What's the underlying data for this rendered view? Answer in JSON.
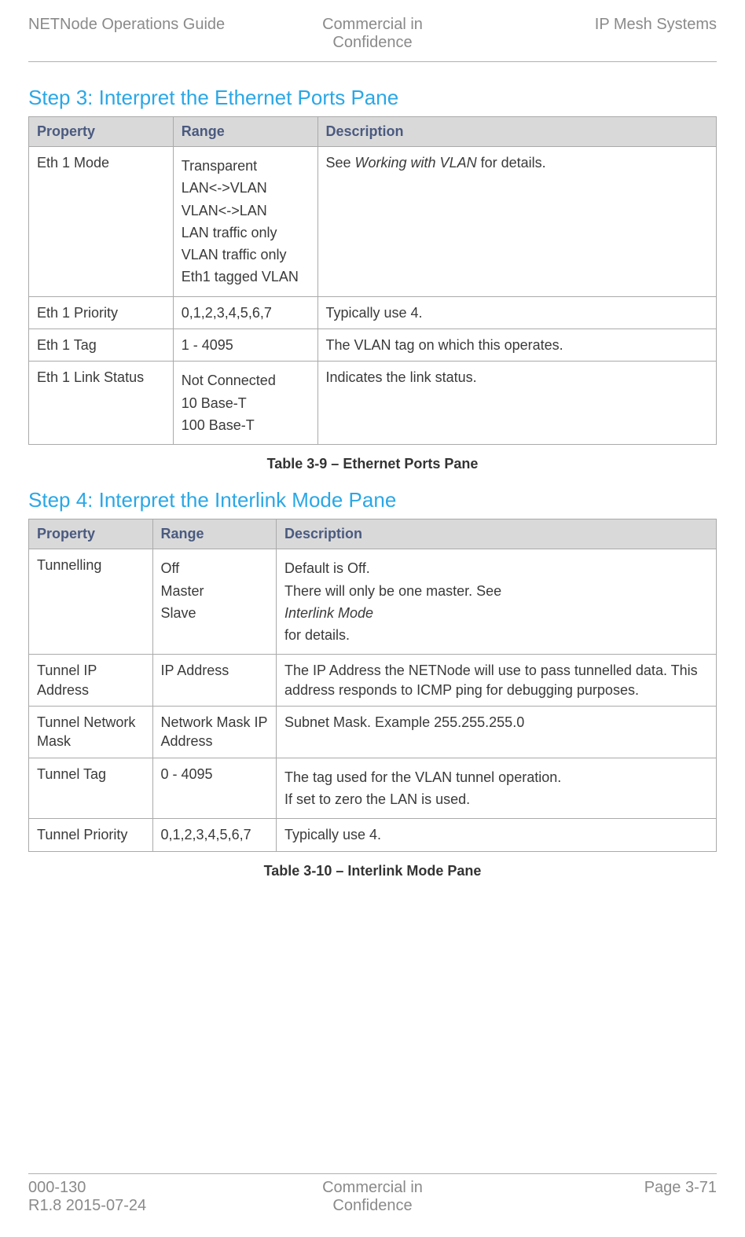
{
  "header": {
    "left": "NETNode Operations Guide",
    "center_l1": "Commercial in",
    "center_l2": "Confidence",
    "right": "IP Mesh Systems"
  },
  "step3": {
    "title": "Step 3: Interpret the Ethernet Ports Pane",
    "cols": {
      "c1": "Property",
      "c2": "Range",
      "c3": "Description"
    },
    "rows": [
      {
        "p": "Eth 1 Mode",
        "r": [
          "Transparent",
          "LAN<->VLAN",
          "VLAN<->LAN",
          "LAN traffic only",
          "VLAN traffic only",
          "Eth1 tagged VLAN"
        ],
        "d_pre": "See ",
        "d_ital": "Working with VLAN",
        "d_post": " for details."
      },
      {
        "p": "Eth 1 Priority",
        "r": [
          "0,1,2,3,4,5,6,7"
        ],
        "d": "Typically use 4."
      },
      {
        "p": "Eth 1 Tag",
        "r": [
          "1 - 4095"
        ],
        "d": "The VLAN tag on which this operates."
      },
      {
        "p": "Eth 1 Link Status",
        "r": [
          "Not Connected",
          "10 Base-T",
          "100 Base-T"
        ],
        "d": "Indicates the link status."
      }
    ],
    "caption": "Table 3-9 – Ethernet Ports Pane"
  },
  "step4": {
    "title": "Step 4: Interpret the Interlink Mode Pane",
    "cols": {
      "c1": "Property",
      "c2": "Range",
      "c3": "Description"
    },
    "rows": [
      {
        "p": "Tunnelling",
        "r": [
          "Off",
          "Master",
          "Slave"
        ],
        "d_lines": [
          {
            "t": "Default is Off."
          },
          {
            "pre": "There will only be one master. See ",
            "ital": "Interlink Mode",
            "post": " for details."
          }
        ]
      },
      {
        "p": "Tunnel IP Address",
        "r": [
          "IP Address"
        ],
        "d": "The IP Address the NETNode will use to pass tunnelled data. This address responds to ICMP ping for debugging purposes."
      },
      {
        "p": "Tunnel Network Mask",
        "r": [
          "Network Mask IP Address"
        ],
        "d": "Subnet Mask. Example 255.255.255.0"
      },
      {
        "p": "Tunnel Tag",
        "r": [
          "0 - 4095"
        ],
        "d_lines": [
          {
            "t": "The tag used for the VLAN tunnel operation."
          },
          {
            "t": "If set to zero the LAN is used."
          }
        ]
      },
      {
        "p": "Tunnel Priority",
        "r": [
          "0,1,2,3,4,5,6,7"
        ],
        "d": "Typically use 4."
      }
    ],
    "caption": "Table 3-10 – Interlink Mode Pane"
  },
  "footer": {
    "left_l1": "000-130",
    "left_l2": "R1.8 2015-07-24",
    "center_l1": "Commercial in",
    "center_l2": "Confidence",
    "right": "Page 3-71"
  }
}
